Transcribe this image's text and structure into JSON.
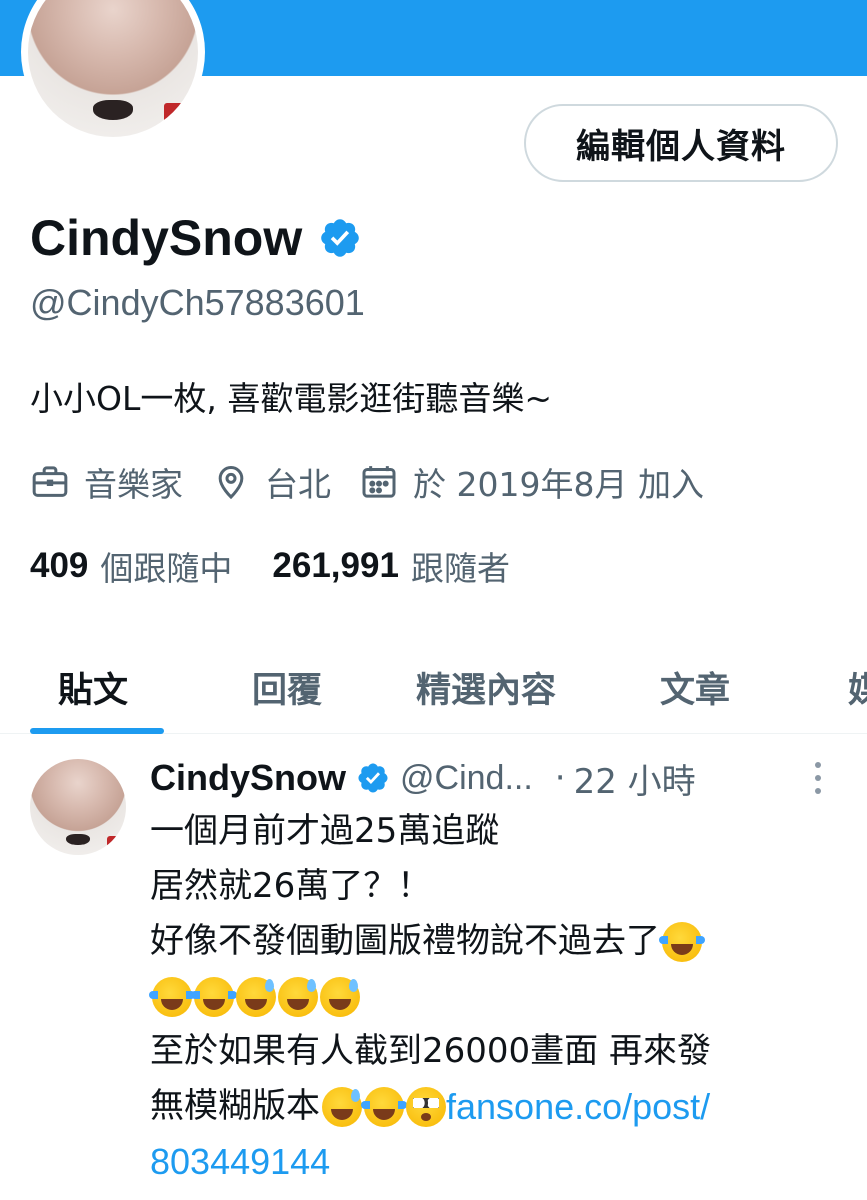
{
  "profile": {
    "edit_button_label": "編輯個人資料",
    "display_name": "CindySnow",
    "handle": "@CindyCh57883601",
    "bio": "小小OL一枚, 喜歡電影逛街聽音樂~",
    "meta": {
      "profession": "音樂家",
      "location": "台北",
      "joined": "於 2019年8月 加入"
    },
    "following_count": "409",
    "following_label": "個跟隨中",
    "followers_count": "261,991",
    "followers_label": "跟隨者"
  },
  "tabs": [
    {
      "label": "貼文",
      "active": true
    },
    {
      "label": "回覆"
    },
    {
      "label": "精選內容"
    },
    {
      "label": "文章"
    },
    {
      "label": "媒"
    }
  ],
  "post": {
    "name": "CindySnow",
    "handle": "@Cind...",
    "separator": "·",
    "time": "22 小時",
    "lines": {
      "l1": "一個月前才過25萬追蹤",
      "l2": "居然就26萬了？！",
      "l3": "好像不發個動圖版禮物說不過去了",
      "l5": "至於如果有人截到26000畫面 再來發",
      "l6": "無模糊版本",
      "link_part1": "fansone.co/post/",
      "link_part2": "803449144"
    }
  },
  "colors": {
    "accent": "#1d9bf0",
    "muted": "#536471",
    "text": "#0f1419"
  }
}
